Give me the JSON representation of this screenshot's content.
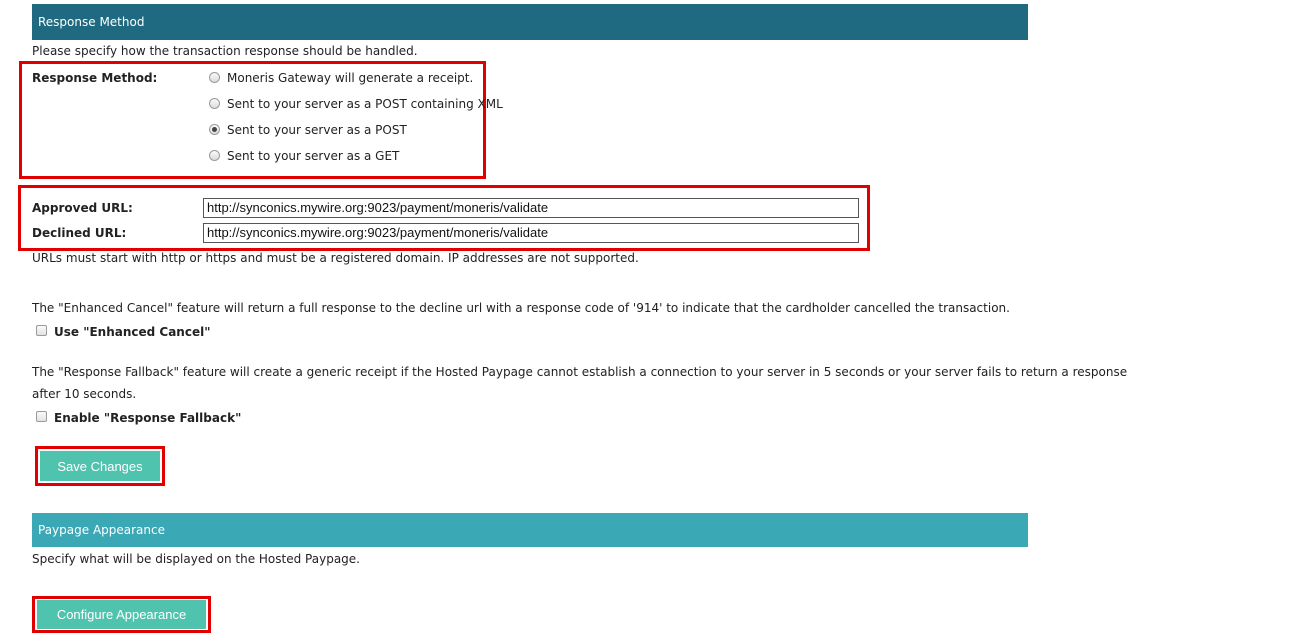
{
  "response_section": {
    "header": "Response Method",
    "intro": "Please specify how the transaction response should be handled.",
    "method_label": "Response Method:",
    "options": [
      {
        "label": "Moneris Gateway will generate a receipt.",
        "checked": false
      },
      {
        "label": "Sent to your server as a POST containing XML",
        "checked": false
      },
      {
        "label": "Sent to your server as a POST",
        "checked": true
      },
      {
        "label": "Sent to your server as a GET",
        "checked": false
      }
    ],
    "approved_label": "Approved URL:",
    "approved_value": "http://synconics.mywire.org:9023/payment/moneris/validate",
    "declined_label": "Declined URL:",
    "declined_value": "http://synconics.mywire.org:9023/payment/moneris/validate",
    "url_note": "URLs must start with http or https and must be a registered domain. IP addresses are not supported.",
    "enhanced_cancel_text": "The \"Enhanced Cancel\" feature will return a full response to the decline url with a response code of '914' to indicate that the cardholder cancelled the transaction.",
    "enhanced_cancel_label": "Use \"Enhanced Cancel\"",
    "enhanced_cancel_checked": false,
    "fallback_text_line1": "The \"Response Fallback\" feature will create a generic receipt if the Hosted Paypage cannot establish a connection to your server in 5 seconds or your server fails to return a response",
    "fallback_text_line2": "after 10 seconds.",
    "fallback_label": "Enable \"Response Fallback\"",
    "fallback_checked": false,
    "save_button": "Save Changes"
  },
  "appearance_section": {
    "header": "Paypage Appearance",
    "intro": "Specify what will be displayed on the Hosted Paypage.",
    "configure_button": "Configure Appearance"
  },
  "colors": {
    "header_dark": "#1f6a80",
    "header_light": "#3aa8b5",
    "button": "#4fc3ad",
    "highlight": "#e00000"
  }
}
